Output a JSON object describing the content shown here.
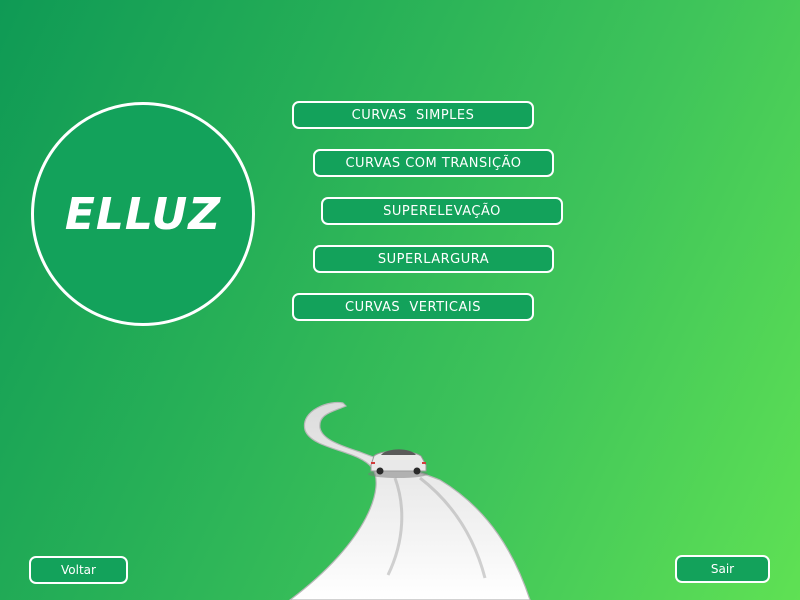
{
  "logo": {
    "text": "ELLUZ"
  },
  "menu": {
    "items": [
      {
        "label": "CURVAS  SIMPLES"
      },
      {
        "label": "CURVAS COM TRANSIÇÃO"
      },
      {
        "label": "SUPERELEVAÇÃO"
      },
      {
        "label": "SUPERLARGURA"
      },
      {
        "label": "CURVAS  VERTICAIS"
      }
    ]
  },
  "footer": {
    "back_label": "Voltar",
    "exit_label": "Sair"
  },
  "colors": {
    "button_bg": "#13a25b",
    "border": "#ffffff",
    "bg_start": "#0f9a55",
    "bg_end": "#5fe154"
  },
  "illustration": {
    "icon": "road-with-car-icon"
  }
}
